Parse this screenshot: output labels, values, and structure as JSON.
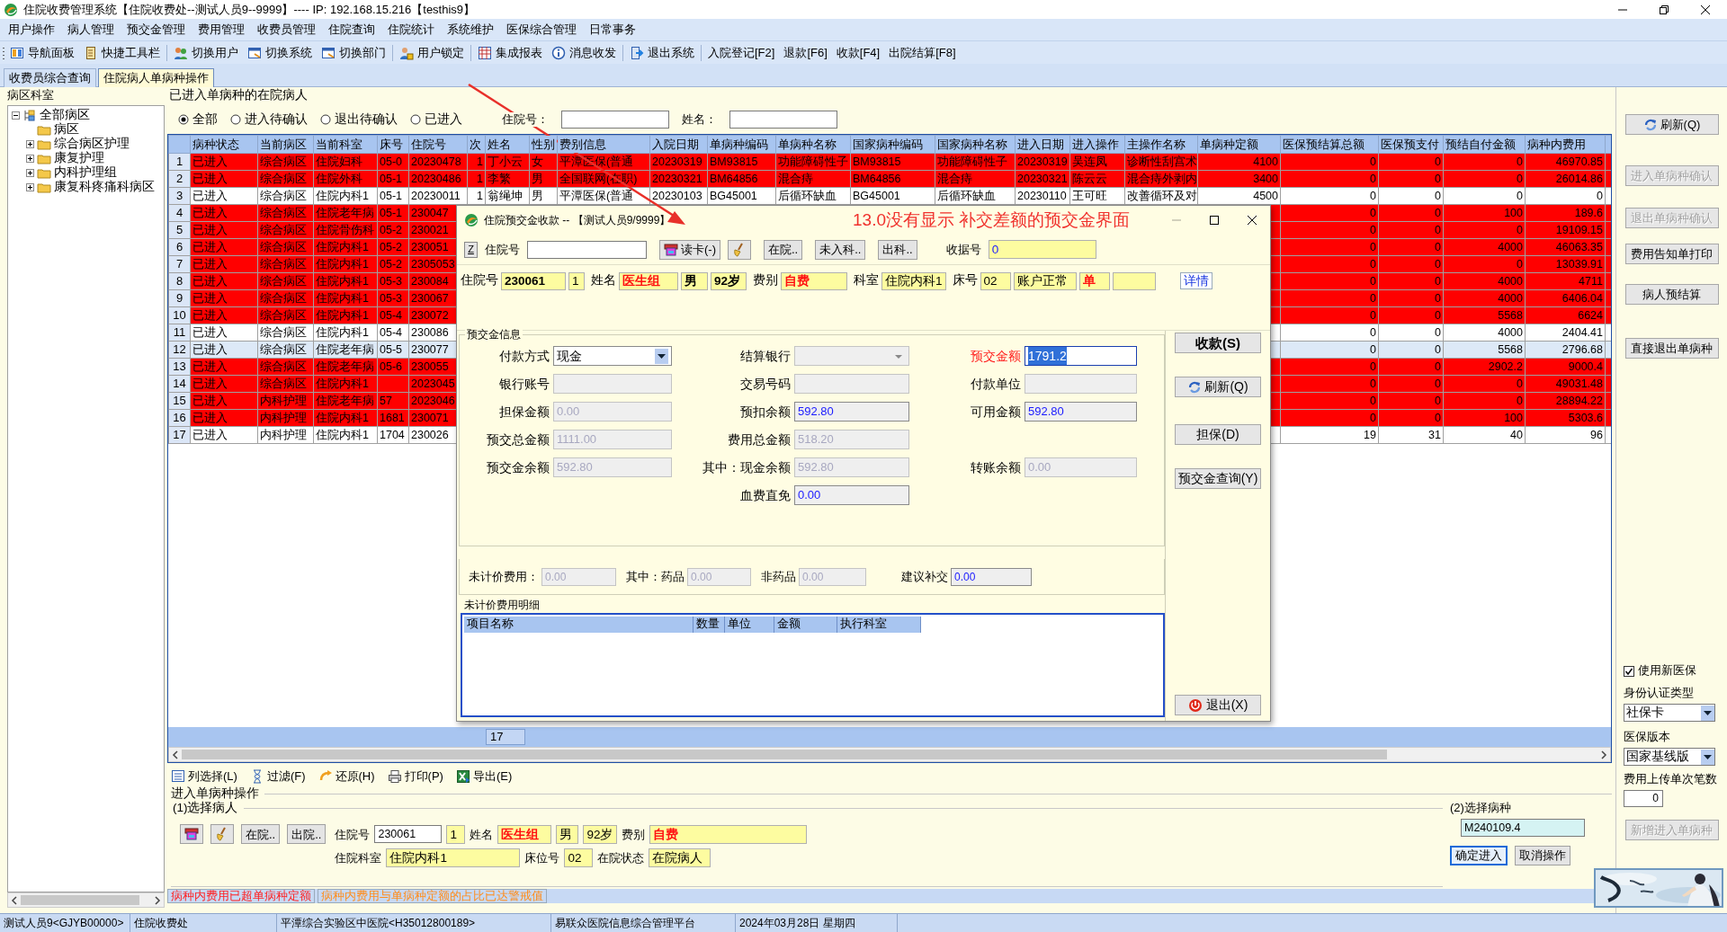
{
  "window": {
    "title": "住院收费管理系统【住院收费处--测试人员9--9999】---- IP: 192.168.15.216【testhis9】"
  },
  "menu": [
    "用户操作",
    "病人管理",
    "预交金管理",
    "费用管理",
    "收费员管理",
    "住院查询",
    "住院统计",
    "系统维护",
    "医保综合管理",
    "日常事务"
  ],
  "toolbar": [
    [
      {
        "label": "导航面板",
        "kind": "icon"
      },
      {
        "label": "快捷工具栏",
        "kind": "icon"
      }
    ],
    [
      {
        "label": "切换用户",
        "kind": "icon"
      },
      {
        "label": "切换系统",
        "kind": "icon"
      },
      {
        "label": "切换部门",
        "kind": "icon"
      }
    ],
    [
      {
        "label": "用户锁定",
        "kind": "icon"
      }
    ],
    [
      {
        "label": "集成报表",
        "kind": "icon"
      },
      {
        "label": "消息收发",
        "kind": "icon"
      }
    ],
    [
      {
        "label": "退出系统",
        "kind": "icon"
      }
    ],
    [
      {
        "label": "入院登记[F2]",
        "kind": "text"
      },
      {
        "label": "退款[F6]",
        "kind": "text"
      },
      {
        "label": "收款[F4]",
        "kind": "text"
      },
      {
        "label": "出院结算[F8]",
        "kind": "text"
      }
    ]
  ],
  "tabs": [
    {
      "label": "收费员综合查询",
      "selected": false
    },
    {
      "label": "住院病人单病种操作",
      "selected": true
    }
  ],
  "ward_panel": {
    "title": "病区科室",
    "tree": [
      {
        "label": "全部病区",
        "expanded": true,
        "children": [
          {
            "label": "病区"
          },
          {
            "label": "综合病区护理",
            "expanded": false
          },
          {
            "label": "康复护理",
            "expanded": false
          },
          {
            "label": "内科护理组",
            "expanded": false
          },
          {
            "label": "康复科疼痛科病区",
            "expanded": false
          }
        ]
      }
    ]
  },
  "patients": {
    "title": "已进入单病种的在院病人",
    "filters": [
      {
        "label": "全部",
        "selected": true
      },
      {
        "label": "进入待确认",
        "selected": false
      },
      {
        "label": "退出待确认",
        "selected": false
      },
      {
        "label": "已进入",
        "selected": false
      }
    ],
    "search_fields": [
      {
        "label": "住院号："
      },
      {
        "label": "姓名："
      }
    ],
    "table": {
      "columns": [
        "病种状态",
        "当前病区",
        "当前科室",
        "床号",
        "住院号",
        "次",
        "姓名",
        "性别",
        "费别信息",
        "入院日期",
        "单病种编码",
        "单病种名称",
        "国家病种编码",
        "国家病种名称",
        "进入日期",
        "进入操作",
        "主操作名称",
        "单病种定额",
        "医保预结算总额",
        "医保预支付",
        "预结自付金额",
        "病种内费用"
      ],
      "rows": [
        {
          "number": "1",
          "alert": true,
          "selected": false,
          "cells": [
            "已进入",
            "综合病区",
            "住院妇科",
            "05-0",
            "20230478",
            "1",
            "丁小云",
            "女",
            "平潭医保(普通",
            "20230319",
            "BM93815",
            "功能障碍性子",
            "BM93815",
            "功能障碍性子",
            "20230319",
            "吴连凤",
            "诊断性刮宫术",
            "4100",
            "0",
            "0",
            "0",
            "46970.85"
          ]
        },
        {
          "number": "2",
          "alert": true,
          "selected": false,
          "cells": [
            "已进入",
            "综合病区",
            "住院外科",
            "05-1",
            "20230486",
            "1",
            "李繁",
            "男",
            "全国联网(在职)",
            "20230321",
            "BM64856",
            "混合痔",
            "BM64856",
            "混合痔",
            "20230321",
            "陈云云",
            "混合痔外剥内",
            "3400",
            "0",
            "0",
            "0",
            "26014.86"
          ]
        },
        {
          "number": "3",
          "alert": false,
          "selected": false,
          "cells": [
            "已进入",
            "综合病区",
            "住院内科1",
            "05-1",
            "20230011",
            "1",
            "翁绳坤",
            "男",
            "平潭医保(普通",
            "20230103",
            "BG45001",
            "后循环缺血",
            "BG45001",
            "后循环缺血",
            "20230110",
            "王可旺",
            "改善循环及对",
            "4500",
            "0",
            "0",
            "0",
            "0"
          ]
        },
        {
          "number": "4",
          "alert": true,
          "selected": false,
          "cells": [
            "已进入",
            "综合病区",
            "住院老年病",
            "05-1",
            "230047",
            null,
            null,
            null,
            null,
            null,
            null,
            null,
            null,
            null,
            null,
            null,
            null,
            null,
            "0",
            "0",
            "100",
            "189.6"
          ]
        },
        {
          "number": "5",
          "alert": true,
          "selected": false,
          "cells": [
            "已进入",
            "综合病区",
            "住院骨伤科",
            "05-2",
            "230021",
            null,
            null,
            null,
            null,
            null,
            null,
            null,
            null,
            null,
            null,
            null,
            null,
            null,
            "0",
            "0",
            "0",
            "19109.15"
          ]
        },
        {
          "number": "6",
          "alert": true,
          "selected": false,
          "cells": [
            "已进入",
            "综合病区",
            "住院内科1",
            "05-2",
            "230051",
            null,
            null,
            null,
            null,
            null,
            null,
            null,
            null,
            null,
            null,
            null,
            null,
            null,
            "0",
            "0",
            "4000",
            "46063.35"
          ]
        },
        {
          "number": "7",
          "alert": true,
          "selected": false,
          "cells": [
            "已进入",
            "综合病区",
            "住院内科1",
            "05-2",
            "2305053",
            null,
            null,
            null,
            null,
            null,
            null,
            null,
            null,
            null,
            null,
            null,
            null,
            null,
            "0",
            "0",
            "0",
            "13039.91"
          ]
        },
        {
          "number": "8",
          "alert": true,
          "selected": false,
          "cells": [
            "已进入",
            "综合病区",
            "住院内科1",
            "05-3",
            "230084",
            null,
            null,
            null,
            null,
            null,
            null,
            null,
            null,
            null,
            null,
            null,
            null,
            null,
            "0",
            "0",
            "4000",
            "4711"
          ]
        },
        {
          "number": "9",
          "alert": true,
          "selected": false,
          "cells": [
            "已进入",
            "综合病区",
            "住院内科1",
            "05-3",
            "230067",
            null,
            null,
            null,
            null,
            null,
            null,
            null,
            null,
            null,
            null,
            null,
            null,
            null,
            "0",
            "0",
            "4000",
            "6406.04"
          ]
        },
        {
          "number": "10",
          "alert": true,
          "selected": false,
          "cells": [
            "已进入",
            "综合病区",
            "住院内科1",
            "05-4",
            "230072",
            null,
            null,
            null,
            null,
            null,
            null,
            null,
            null,
            null,
            null,
            null,
            null,
            null,
            "0",
            "0",
            "5568",
            "6624"
          ]
        },
        {
          "number": "11",
          "alert": false,
          "selected": false,
          "cells": [
            "已进入",
            "综合病区",
            "住院内科1",
            "05-4",
            "230086",
            null,
            null,
            null,
            null,
            null,
            null,
            null,
            null,
            null,
            null,
            null,
            null,
            null,
            "0",
            "0",
            "4000",
            "2404.41"
          ]
        },
        {
          "number": "12",
          "alert": false,
          "selected": true,
          "cells": [
            "已进入",
            "综合病区",
            "住院老年病",
            "05-5",
            "230077",
            null,
            null,
            null,
            null,
            null,
            null,
            null,
            null,
            null,
            null,
            null,
            null,
            null,
            "0",
            "0",
            "5568",
            "2796.68"
          ]
        },
        {
          "number": "13",
          "alert": true,
          "selected": false,
          "cells": [
            "已进入",
            "综合病区",
            "住院老年病",
            "05-6",
            "230055",
            null,
            null,
            null,
            null,
            null,
            null,
            null,
            null,
            null,
            null,
            null,
            null,
            null,
            "0",
            "0",
            "2902.2",
            "9000.4"
          ]
        },
        {
          "number": "14",
          "alert": true,
          "selected": false,
          "cells": [
            "已进入",
            "综合病区",
            "住院内科1",
            null,
            "2023045",
            null,
            null,
            null,
            null,
            null,
            null,
            null,
            null,
            null,
            null,
            null,
            null,
            null,
            "0",
            "0",
            "0",
            "49031.48"
          ]
        },
        {
          "number": "15",
          "alert": true,
          "selected": false,
          "cells": [
            "已进入",
            "内科护理",
            "住院老年病",
            "57",
            "2023046",
            null,
            null,
            null,
            null,
            null,
            null,
            null,
            null,
            null,
            null,
            null,
            null,
            null,
            "0",
            "0",
            "0",
            "28894.22"
          ]
        },
        {
          "number": "16",
          "alert": true,
          "selected": false,
          "cells": [
            "已进入",
            "内科护理",
            "住院内科1",
            "1681",
            "230071",
            null,
            null,
            null,
            null,
            null,
            null,
            null,
            null,
            null,
            null,
            null,
            null,
            null,
            "0",
            "0",
            "100",
            "5303.6"
          ]
        },
        {
          "number": "17",
          "alert": false,
          "selected": false,
          "cells": [
            "已进入",
            "内科护理",
            "住院内科1",
            "1704",
            "230026",
            null,
            null,
            null,
            null,
            null,
            null,
            null,
            null,
            null,
            null,
            null,
            null,
            null,
            "19",
            "31",
            "40",
            "96"
          ]
        }
      ],
      "footer_count": "17"
    },
    "tools": [
      "列选择(L)",
      "过滤(F)",
      "还原(H)",
      "打印(P)",
      "导出(E)"
    ]
  },
  "operation": {
    "title": "进入单病种操作",
    "patient_group": {
      "title": "(1)选择病人",
      "buttons": [
        {
          "kind": "card"
        },
        {
          "kind": "broom"
        },
        {
          "kind": "text",
          "label": "在院.."
        },
        {
          "kind": "text",
          "label": "出院.."
        }
      ],
      "upper_fields": [
        {
          "label": "住院号",
          "value": "230061",
          "kind": "input"
        },
        {
          "value": "1",
          "kind": "display"
        },
        {
          "label": "姓名",
          "value": "医生组",
          "kind": "alert"
        },
        {
          "value": "男",
          "kind": "display"
        },
        {
          "value": "92岁",
          "kind": "display"
        },
        {
          "label": "费别",
          "value": "自费",
          "kind": "alert"
        }
      ],
      "lower_fields": [
        {
          "label": "住院科室",
          "value": "住院内科1",
          "kind": "display"
        },
        {
          "label": "床位号",
          "value": "02",
          "kind": "display"
        },
        {
          "label": "在院状态",
          "value": "在院病人",
          "kind": "display"
        }
      ]
    },
    "disease_group": {
      "title": "(2)选择病种",
      "code": "M240109.4",
      "buttons": [
        {
          "label": "确定进入",
          "focused": true
        },
        {
          "label": "取消操作",
          "focused": false
        }
      ]
    }
  },
  "legend": [
    {
      "text": "病种内费用已超单病种定额",
      "color": "#ff2020"
    },
    {
      "text": "病种内费用与单病种定额的占比已达警戒值",
      "color": "#ff8c1a"
    }
  ],
  "right_panel": {
    "buttons": [
      {
        "label": "刷新(Q)",
        "kind": "refresh",
        "disabled": false
      },
      {
        "label": "进入单病种确认",
        "kind": "plain",
        "disabled": true
      },
      {
        "label": "退出单病种确认",
        "kind": "plain",
        "disabled": true
      },
      {
        "label": "费用告知单打印",
        "kind": "plain",
        "disabled": false
      },
      {
        "label": "病人预结算",
        "kind": "plain",
        "disabled": false
      },
      {
        "label": "直接退出单病种",
        "kind": "plain",
        "disabled": false
      }
    ],
    "new_insurance": {
      "label": "使用新医保",
      "checked": true
    },
    "id_type": {
      "label": "身份认证类型",
      "value": "社保卡"
    },
    "version": {
      "label": "医保版本",
      "value": "国家基线版"
    },
    "upload_count": {
      "label": "费用上传单次笔数",
      "value": "0"
    },
    "add_button": {
      "label": "新增进入单病种",
      "disabled": true
    }
  },
  "status_bar": [
    "测试人员9<GJYB00000>",
    "住院收费处",
    "平潭综合实验区中医院<H35012800189>",
    "易联众医院信息综合管理平台",
    "2024年03月28日 星期四"
  ],
  "dialog": {
    "title": "住院预交金收款 -- 【测试人员9/9999】",
    "lookup": {
      "key_button": "Z",
      "label": "住院号",
      "buttons": [
        {
          "kind": "card",
          "label": "读卡(-)"
        },
        {
          "kind": "broom"
        },
        {
          "kind": "text",
          "label": "在院.."
        },
        {
          "kind": "text",
          "label": "未入科.."
        },
        {
          "kind": "text",
          "label": "出科.."
        }
      ],
      "receipt_label": "收据号",
      "receipt_value": "0"
    },
    "patient": [
      {
        "label": "住院号",
        "value": "230061",
        "kind": "strong"
      },
      {
        "value": "1",
        "kind": "plain"
      },
      {
        "label": "姓名",
        "value": "医生组",
        "kind": "alert"
      },
      {
        "value": "男",
        "kind": "strong"
      },
      {
        "value": "92岁",
        "kind": "strong"
      },
      {
        "label": "费别",
        "value": "自费",
        "kind": "alert"
      },
      {
        "label": "科室",
        "value": "住院内科1",
        "kind": "plain"
      },
      {
        "label": "床号",
        "value": "02",
        "kind": "plain"
      },
      {
        "value": "账户正常",
        "kind": "plain"
      },
      {
        "value": "单",
        "kind": "alert"
      },
      {
        "kind": "blank"
      }
    ],
    "details_link": "详情",
    "group_title": "预交金信息",
    "field_rows": [
      {
        "left": {
          "label": "付款方式",
          "kind": "select",
          "value": "现金",
          "disabled": false,
          "editable": true,
          "focused": false,
          "required": false
        },
        "middle": {
          "label": "结算银行",
          "kind": "select",
          "disabled": true,
          "editable": false,
          "focused": false,
          "required": false
        },
        "right": {
          "label": "预交金额",
          "kind": "input",
          "value": "1791.2",
          "disabled": false,
          "editable": true,
          "focused": true,
          "required": true
        }
      },
      {
        "left": {
          "label": "银行账号",
          "kind": "input",
          "disabled": true,
          "editable": false,
          "focused": false,
          "required": false
        },
        "middle": {
          "label": "交易号码",
          "kind": "input",
          "disabled": true,
          "editable": false,
          "focused": false,
          "required": false
        },
        "right": {
          "label": "付款单位",
          "kind": "input",
          "disabled": true,
          "editable": false,
          "focused": false,
          "required": false
        }
      },
      {
        "left": {
          "label": "担保金额",
          "kind": "input",
          "value": "0.00",
          "disabled": true,
          "editable": false,
          "focused": false,
          "required": false
        },
        "middle": {
          "label": "预扣余额",
          "kind": "input",
          "value": "592.80",
          "disabled": false,
          "editable": false,
          "focused": false,
          "required": false
        },
        "right": {
          "label": "可用金额",
          "kind": "input",
          "value": "592.80",
          "disabled": false,
          "editable": false,
          "focused": false,
          "required": false
        }
      },
      {
        "left": {
          "label": "预交总金额",
          "kind": "input",
          "value": "1111.00",
          "disabled": true,
          "editable": false,
          "focused": false,
          "required": false
        },
        "middle": {
          "label": "费用总金额",
          "kind": "input",
          "value": "518.20",
          "disabled": true,
          "editable": false,
          "focused": false,
          "required": false
        }
      },
      {
        "left": {
          "label": "预交金余额",
          "kind": "input",
          "value": "592.80",
          "disabled": true,
          "editable": false,
          "focused": false,
          "required": false
        },
        "middle": {
          "label": "其中：现金余额",
          "kind": "input",
          "value": "592.80",
          "disabled": true,
          "editable": false,
          "focused": false,
          "required": false
        },
        "right": {
          "label": "转账余额",
          "kind": "input",
          "value": "0.00",
          "disabled": true,
          "editable": false,
          "focused": false,
          "required": false
        }
      },
      {
        "middle": {
          "label": "血费直免",
          "kind": "input",
          "value": "0.00",
          "disabled": false,
          "editable": false,
          "focused": false,
          "required": false
        }
      }
    ],
    "unpriced": [
      {
        "label": "未计价费用：",
        "value": "0.00",
        "disabled": true
      },
      {
        "label": "其中：药品",
        "value": "0.00",
        "disabled": true
      },
      {
        "label": "非药品",
        "value": "0.00",
        "disabled": true
      },
      {
        "label": "建议补交",
        "value": "0.00",
        "disabled": false
      }
    ],
    "detail_title": "未计价费用明细",
    "detail_columns": [
      "项目名称",
      "数量",
      "单位",
      "金额",
      "执行科室"
    ],
    "buttons": [
      {
        "label": "收款(S)",
        "kind": "primary"
      },
      {
        "label": "刷新(Q)",
        "kind": "refresh"
      },
      {
        "label": "担保(D)",
        "kind": "plain"
      },
      {
        "label": "预交金查询(Y)",
        "kind": "plain"
      },
      {
        "label": "退出(X)",
        "kind": "exit"
      }
    ]
  },
  "annotation": {
    "text": "13.0没有显示 补交差额的预交金界面"
  }
}
